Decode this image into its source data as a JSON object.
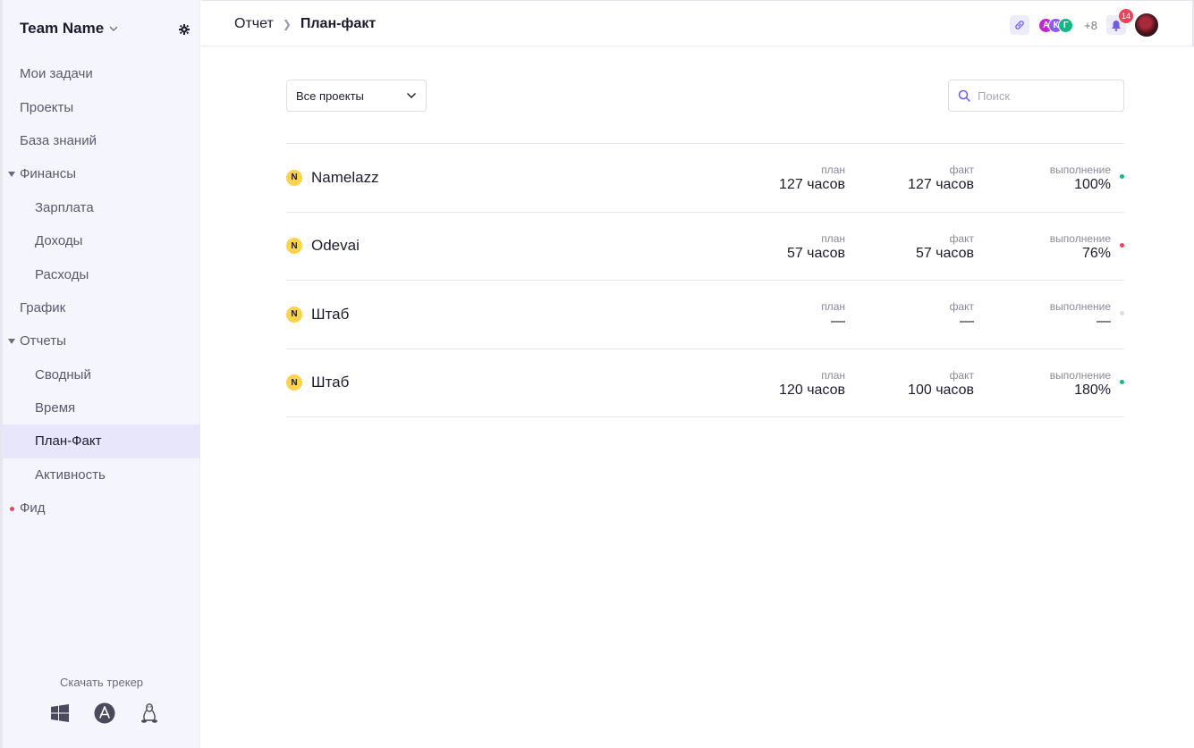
{
  "sidebar": {
    "team_name": "Team Name",
    "items": [
      {
        "label": "Мои задачи",
        "level": 1
      },
      {
        "label": "Проекты",
        "level": 1
      },
      {
        "label": "База знаний",
        "level": 1
      },
      {
        "label": "Финансы",
        "level": 1,
        "expanded": true
      },
      {
        "label": "Зарплата",
        "level": 2
      },
      {
        "label": "Доходы",
        "level": 2
      },
      {
        "label": "Расходы",
        "level": 2
      },
      {
        "label": "График",
        "level": 1
      },
      {
        "label": "Отчеты",
        "level": 1,
        "expanded": true
      },
      {
        "label": "Сводный",
        "level": 2
      },
      {
        "label": "Время",
        "level": 2
      },
      {
        "label": "План-Факт",
        "level": 2,
        "active": true
      },
      {
        "label": "Активность",
        "level": 2
      },
      {
        "label": "Фид",
        "level": 1,
        "unread": true
      }
    ],
    "download_label": "Скачать трекер",
    "os_icons": [
      "windows-icon",
      "appstore-icon",
      "linux-icon"
    ]
  },
  "header": {
    "crumb_parent": "Отчет",
    "crumb_current": "План-факт",
    "avatars": [
      {
        "letter": "А",
        "color": "#c026d3"
      },
      {
        "letter": "К",
        "color": "#8b5cf6"
      },
      {
        "letter": "Г",
        "color": "#10b981"
      }
    ],
    "more_count": "+8",
    "notifications": "14"
  },
  "filter": {
    "label": "Все проекты"
  },
  "search": {
    "placeholder": "Поиск"
  },
  "metric_labels": {
    "plan": "план",
    "fact": "факт",
    "completion": "выполнение"
  },
  "projects": [
    {
      "icon": "N",
      "name": "Namelazz",
      "plan": "127 часов",
      "fact": "127 часов",
      "completion": "100%",
      "status_color": "#10b981"
    },
    {
      "icon": "N",
      "name": "Odevai",
      "plan": "57 часов",
      "fact": "57 часов",
      "completion": "76%",
      "status_color": "#f0435b"
    },
    {
      "icon": "N",
      "name": "Штаб",
      "plan": "—",
      "fact": "—",
      "completion": "—",
      "status_color": "#dcdce4"
    },
    {
      "icon": "N",
      "name": "Штаб",
      "plan": "120 часов",
      "fact": "100 часов",
      "completion": "180%",
      "status_color": "#10b981"
    }
  ],
  "colors": {
    "accent": "#e7e6fb",
    "sidebar_bg": "#f5f5fd"
  }
}
